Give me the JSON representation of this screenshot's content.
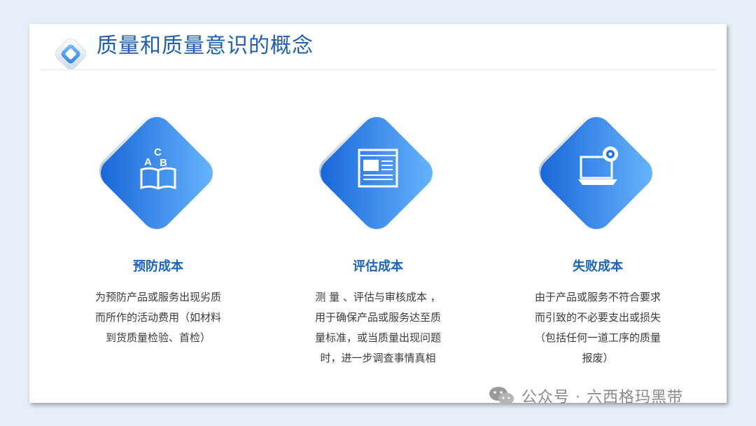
{
  "slide": {
    "title": "质量和质量意识的概念"
  },
  "cards": [
    {
      "title": "预防成本",
      "icon": "abc-book-icon",
      "desc_lines": [
        "为预防产品或服务出现劣质",
        "而所作的活动费用（如材料",
        "到货质量检验、首检）"
      ]
    },
    {
      "title": "评估成本",
      "icon": "document-page-icon",
      "desc_lines": [
        "测 量 、评估与审核成本 ，",
        "用于确保产品或服务达至质",
        "量标准，或当质量出现问题",
        "时，进一步调查事情真相"
      ]
    },
    {
      "title": "失败成本",
      "icon": "laptop-webcam-icon",
      "desc_lines": [
        "由于产品或服务不符合要求",
        "而引致的不必要支出或损失",
        "（包括任何一道工序的质量",
        "报废）"
      ]
    }
  ],
  "watermark": {
    "text": "公众号 · 六西格玛黑带",
    "icon": "wechat-icon"
  },
  "colors": {
    "accent": "#1f5fae",
    "diamond_light": "#5fb0ff",
    "diamond_dark": "#1566d6",
    "background": "#e6eef8"
  }
}
